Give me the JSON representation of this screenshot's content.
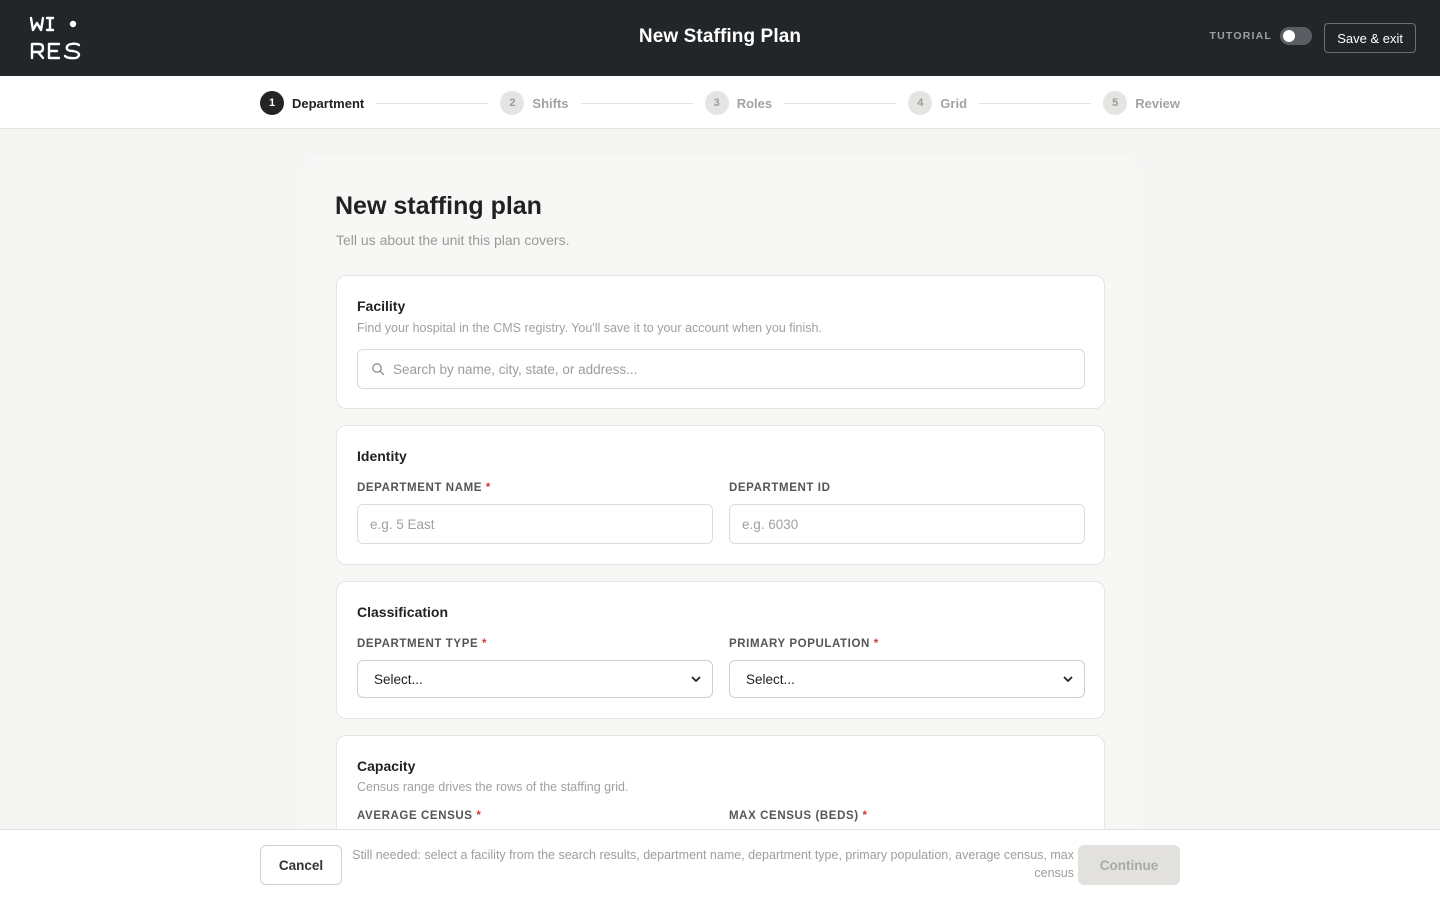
{
  "header": {
    "logo_text": "WI RES",
    "title": "New Staffing Plan",
    "tutorial_label": "TUTORIAL",
    "tutorial_on": false,
    "save_exit_label": "Save & exit"
  },
  "stepper": {
    "steps": [
      {
        "num": "1",
        "label": "Department",
        "active": true
      },
      {
        "num": "2",
        "label": "Shifts",
        "active": false
      },
      {
        "num": "3",
        "label": "Roles",
        "active": false
      },
      {
        "num": "4",
        "label": "Grid",
        "active": false
      },
      {
        "num": "5",
        "label": "Review",
        "active": false
      }
    ]
  },
  "page": {
    "title": "New staffing plan",
    "subtitle": "Tell us about the unit this plan covers."
  },
  "facility": {
    "title": "Facility",
    "description": "Find your hospital in the CMS registry. You'll save it to your account when you finish.",
    "search_placeholder": "Search by name, city, state, or address...",
    "search_value": ""
  },
  "identity": {
    "title": "Identity",
    "dept_name_label": "DEPARTMENT NAME",
    "dept_name_placeholder": "e.g. 5 East",
    "dept_id_label": "DEPARTMENT ID",
    "dept_id_placeholder": "e.g. 6030"
  },
  "classification": {
    "title": "Classification",
    "dept_type_label": "DEPARTMENT TYPE",
    "dept_type_value": "Select...",
    "population_label": "PRIMARY POPULATION",
    "population_value": "Select..."
  },
  "capacity": {
    "title": "Capacity",
    "description": "Census range drives the rows of the staffing grid.",
    "avg_census_label": "AVERAGE CENSUS",
    "max_census_label": "MAX CENSUS (BEDS)"
  },
  "required_marker": "*",
  "footer": {
    "cancel_label": "Cancel",
    "still_needed": "Still needed: select a facility from the search results, department name, department type, primary population, average census, max census",
    "continue_label": "Continue"
  },
  "colors": {
    "header_bg": "#232629",
    "required": "#d23a3a",
    "active_step": "#222426"
  }
}
